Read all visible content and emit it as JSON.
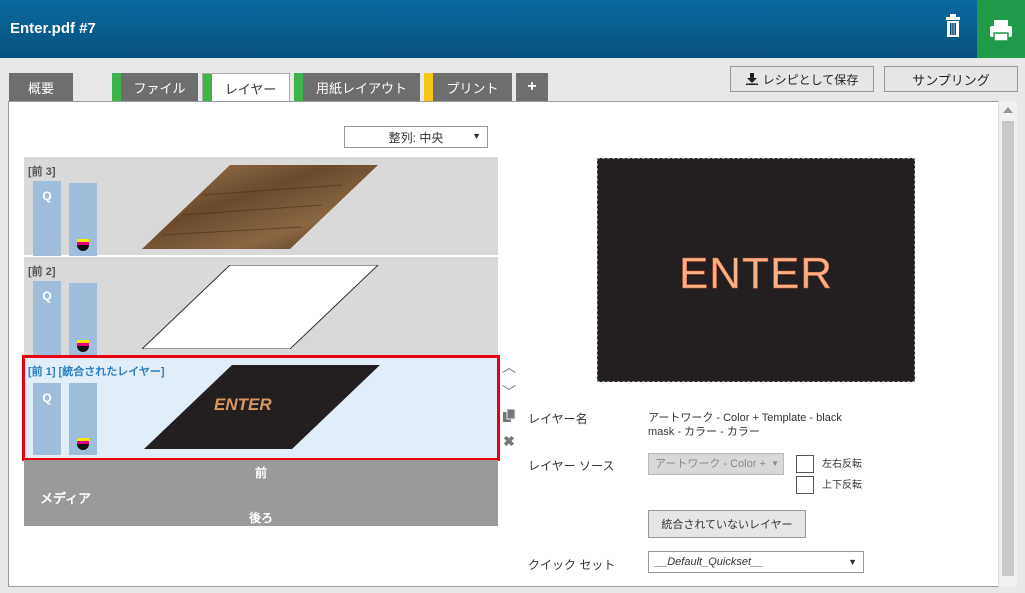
{
  "header": {
    "title": "Enter.pdf #7",
    "trash_icon": "trash-icon",
    "print_icon": "printer-icon"
  },
  "tabs": [
    {
      "label": "概要",
      "marker": ""
    },
    {
      "label": "ファイル",
      "marker": "#3cb44a"
    },
    {
      "label": "レイヤー",
      "marker": "#3cb44a"
    },
    {
      "label": "用紙レイアウト",
      "marker": "#3cb44a"
    },
    {
      "label": "プリント",
      "marker": "#f5c518"
    },
    {
      "label": "+",
      "marker": ""
    }
  ],
  "toolbar": {
    "save_recipe": "レシピとして保存",
    "sampling": "サンプリング"
  },
  "sort": {
    "value": "整列: 中央"
  },
  "layers": [
    {
      "name": "[前 3]",
      "q": "Q",
      "content": "wood"
    },
    {
      "name": "[前 2]",
      "q": "Q",
      "content": "white"
    },
    {
      "name": "[前 1] [統合されたレイヤー]",
      "q": "Q",
      "content": "ENTER"
    }
  ],
  "media": {
    "front": "前",
    "label": "メディア",
    "back": "後ろ"
  },
  "preview": {
    "text": "ENTER"
  },
  "props": {
    "layer_name_label": "レイヤー名",
    "layer_name_value_1": "アートワーク - Color + Template - black",
    "layer_name_value_2": "mask - カラー - カラー",
    "layer_source_label": "レイヤー ソース",
    "layer_source_value": "アートワーク - Color +",
    "flip_h": "左右反転",
    "flip_v": "上下反転",
    "unlinked_layer_button": "統合されていないレイヤー",
    "quickset_label": "クイック セット",
    "quickset_value": "__Default_Quickset__"
  },
  "colors": {
    "header": "#07507c",
    "print": "#1e9a48",
    "selection": "#e60012",
    "enter_text": "#f6b08a"
  }
}
